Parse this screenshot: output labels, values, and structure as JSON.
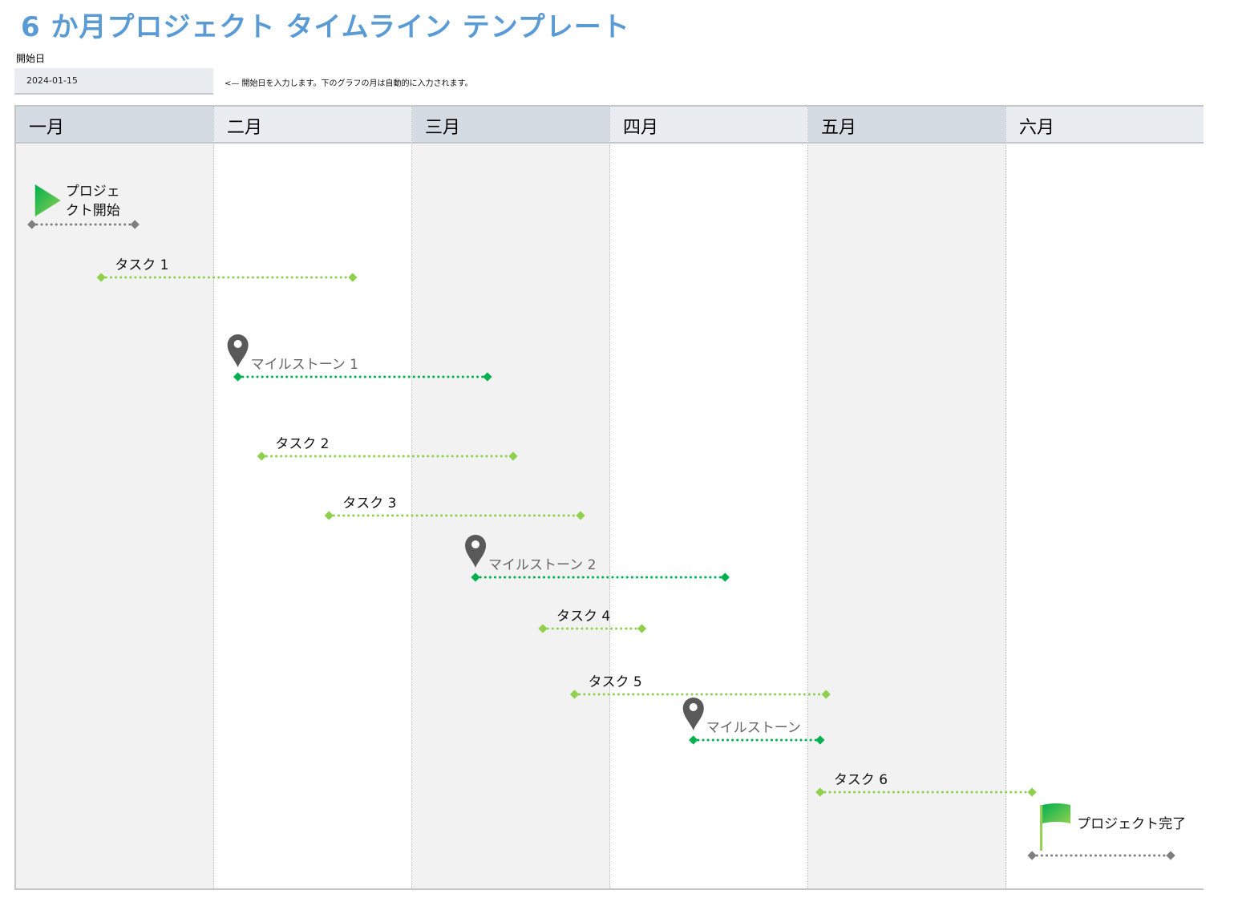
{
  "header": {
    "title": "6 か月プロジェクト タイムライン テンプレート",
    "start_date_label": "開始日",
    "start_date_value": "2024-01-15",
    "hint": "<— 開始日を入力します。下のグラフの月は自動的に入力されます。"
  },
  "months": [
    "一月",
    "二月",
    "三月",
    "四月",
    "五月",
    "六月"
  ],
  "colors": {
    "title": "#5b9bd5",
    "task": "#8fd14f",
    "milestone": "#00b050",
    "endpoint": "#7f7f7f",
    "pin": "#595959"
  },
  "chart_data": {
    "type": "timeline",
    "x_unit": "month-index (0 = 一月 start, 6 = 六月 end)",
    "items": [
      {
        "label": "プロジェクト開始",
        "kind": "start",
        "icon": "play-triangle-icon",
        "start": 0.08,
        "end": 0.6
      },
      {
        "label": "タスク 1",
        "kind": "task",
        "start": 0.43,
        "end": 1.7
      },
      {
        "label": "マイルストーン 1",
        "kind": "milestone",
        "icon": "map-pin-icon",
        "start": 1.12,
        "end": 2.38
      },
      {
        "label": "タスク 2",
        "kind": "task",
        "start": 1.24,
        "end": 2.51
      },
      {
        "label": "タスク 3",
        "kind": "task",
        "start": 1.58,
        "end": 2.85
      },
      {
        "label": "マイルストーン 2",
        "kind": "milestone",
        "icon": "map-pin-icon",
        "start": 2.32,
        "end": 3.58
      },
      {
        "label": "タスク 4",
        "kind": "task",
        "start": 2.66,
        "end": 3.16
      },
      {
        "label": "タスク 5",
        "kind": "task",
        "start": 2.82,
        "end": 4.09
      },
      {
        "label": "マイルストーン",
        "kind": "milestone",
        "icon": "map-pin-icon",
        "start": 3.42,
        "end": 4.06
      },
      {
        "label": "タスク 6",
        "kind": "task",
        "start": 4.06,
        "end": 5.13
      },
      {
        "label": "プロジェクト完了",
        "kind": "end",
        "icon": "flag-icon",
        "start": 5.13,
        "end": 5.83
      }
    ]
  }
}
